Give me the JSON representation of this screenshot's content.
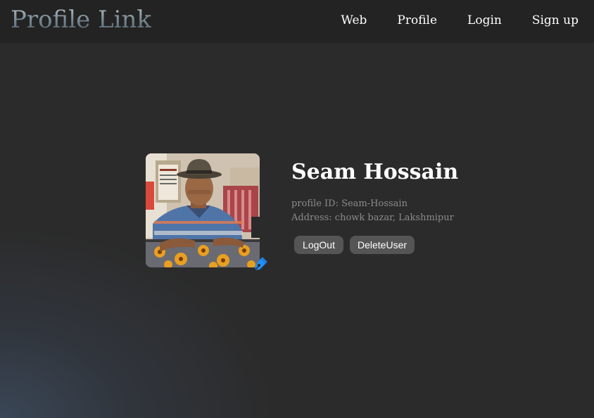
{
  "navbar": {
    "brand": "Profile Link",
    "items": [
      {
        "label": "Web"
      },
      {
        "label": "Profile"
      },
      {
        "label": "Login"
      },
      {
        "label": "Sign up"
      }
    ]
  },
  "profile": {
    "photo_alt": "Profile photo",
    "name": "Seam Hossain",
    "profile_id": "profile ID: Seam-Hossain",
    "address": "Address: chowk bazar, Lakshmipur",
    "edit_icon": "pen-nib-icon",
    "buttons": {
      "logout": "LogOut",
      "delete": "DeleteUser"
    }
  },
  "colors": {
    "edit_icon": "#1e90ff",
    "button_bg": "#555555",
    "navbar_bg": "#232323"
  }
}
